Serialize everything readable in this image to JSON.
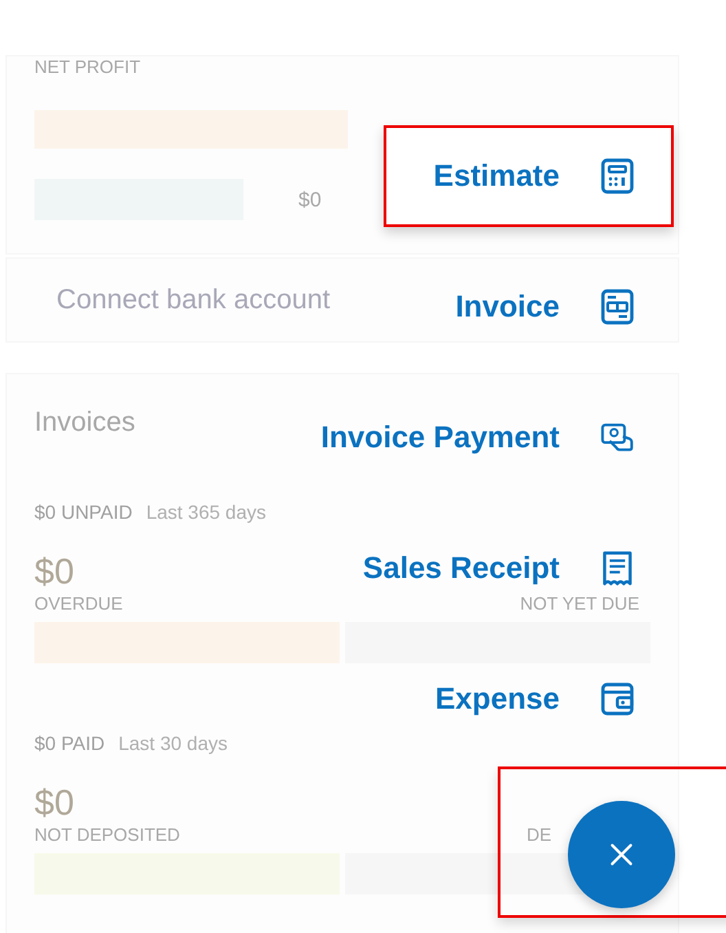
{
  "background": {
    "net_profit": {
      "title": "NET PROFIT",
      "amount": "$0"
    },
    "bank": {
      "label": "Connect bank account"
    },
    "invoices": {
      "title": "Invoices",
      "unpaid": {
        "amount": "$0 UNPAID",
        "period": "Last 365 days",
        "big_amount": "$0",
        "left_label": "OVERDUE",
        "right_label": "NOT YET DUE"
      },
      "paid": {
        "amount": "$0 PAID",
        "period": "Last 30 days",
        "big_amount": "$0",
        "left_label": "NOT DEPOSITED",
        "right_label": "DE"
      }
    }
  },
  "menu": [
    {
      "label": "Estimate",
      "kind": "estimate",
      "highlighted": true
    },
    {
      "label": "Invoice",
      "kind": "invoice",
      "highlighted": false
    },
    {
      "label": "Invoice Payment",
      "kind": "payment",
      "highlighted": false
    },
    {
      "label": "Sales Receipt",
      "kind": "receipt",
      "highlighted": false
    },
    {
      "label": "Expense",
      "kind": "expense",
      "highlighted": false
    }
  ],
  "fab": {
    "highlighted": true
  }
}
